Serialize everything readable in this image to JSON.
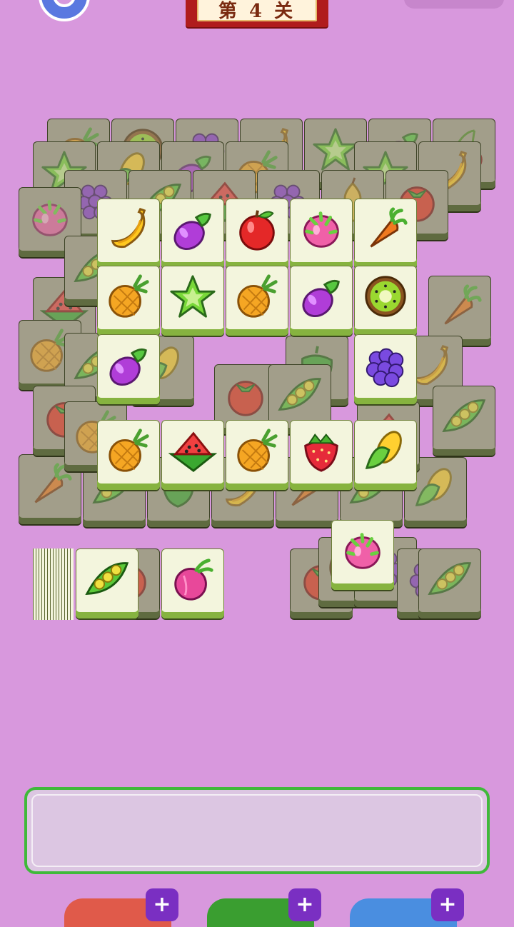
{
  "game": {
    "level_label": "第 4 关",
    "settings_icon": "gear-icon",
    "colors": {
      "background": "#d898dd",
      "tile_face": "#f3f5dd",
      "tile_edge": "#86b33f",
      "tray_border": "#3fb93a",
      "banner": "#b01c1c",
      "powerup_red": "#e05a4a",
      "powerup_green": "#3a9e30",
      "powerup_blue": "#4a8ee0",
      "plus_badge": "#7a2fc2"
    }
  },
  "board": {
    "buried_tiles": [
      "pineapple",
      "kiwi",
      "grape",
      "banana",
      "star-fruit",
      "eggplant",
      "cherry",
      "star-fruit",
      "corn",
      "eggplant",
      "pineapple",
      "star-fruit",
      "banana",
      "grape",
      "pea-pod",
      "watermelon",
      "grape",
      "pear",
      "tomato",
      "dragon-fruit",
      "watermelon",
      "pea-pod",
      "carrot",
      "pineapple",
      "pea-pod",
      "corn",
      "tomato",
      "pepper",
      "banana",
      "carrot",
      "pea-pod"
    ],
    "top_tiles": [
      [
        "banana",
        "eggplant",
        "apple",
        "dragon-fruit",
        "carrot"
      ],
      [
        "pineapple",
        "star-fruit",
        "pineapple",
        "eggplant",
        "kiwi"
      ],
      [
        "eggplant",
        "",
        "",
        "",
        "blackberry"
      ],
      [
        "pineapple",
        "watermelon",
        "pineapple",
        "strawberry",
        "corn"
      ]
    ],
    "side_stack_top": "dragon-fruit"
  },
  "deck": {
    "top_tile": "pea-pod",
    "next_tile": "onion"
  },
  "tray": {
    "slots": []
  },
  "powerups": [
    {
      "name": "undo",
      "plus": "+"
    },
    {
      "name": "hint",
      "plus": "+"
    },
    {
      "name": "shuffle",
      "plus": "+"
    }
  ]
}
